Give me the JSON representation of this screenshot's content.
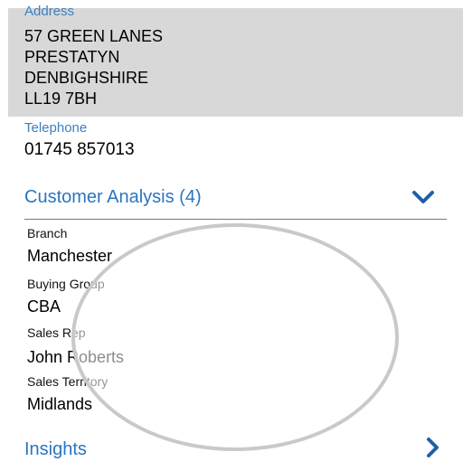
{
  "address": {
    "label": "Address",
    "lines": [
      "57 GREEN LANES",
      "PRESTATYN",
      "DENBIGHSHIRE",
      "LL19 7BH"
    ]
  },
  "telephone": {
    "label": "Telephone",
    "value": "01745 857013"
  },
  "customer_analysis": {
    "header": "Customer Analysis (4)",
    "fields": [
      {
        "label": "Branch",
        "value": "Manchester"
      },
      {
        "label": "Buying Group",
        "value": "CBA"
      },
      {
        "label": "Sales Rep",
        "value": "John Roberts"
      },
      {
        "label": "Sales Territory",
        "value": "Midlands"
      }
    ]
  },
  "insights": {
    "header": "Insights"
  },
  "icons": {
    "expand": "chevron-down-icon",
    "navigate": "chevron-right-icon"
  },
  "colors": {
    "accent": "#2a75c0",
    "label_blue": "#3d7fbf",
    "address_bg": "#d8d8d8"
  }
}
